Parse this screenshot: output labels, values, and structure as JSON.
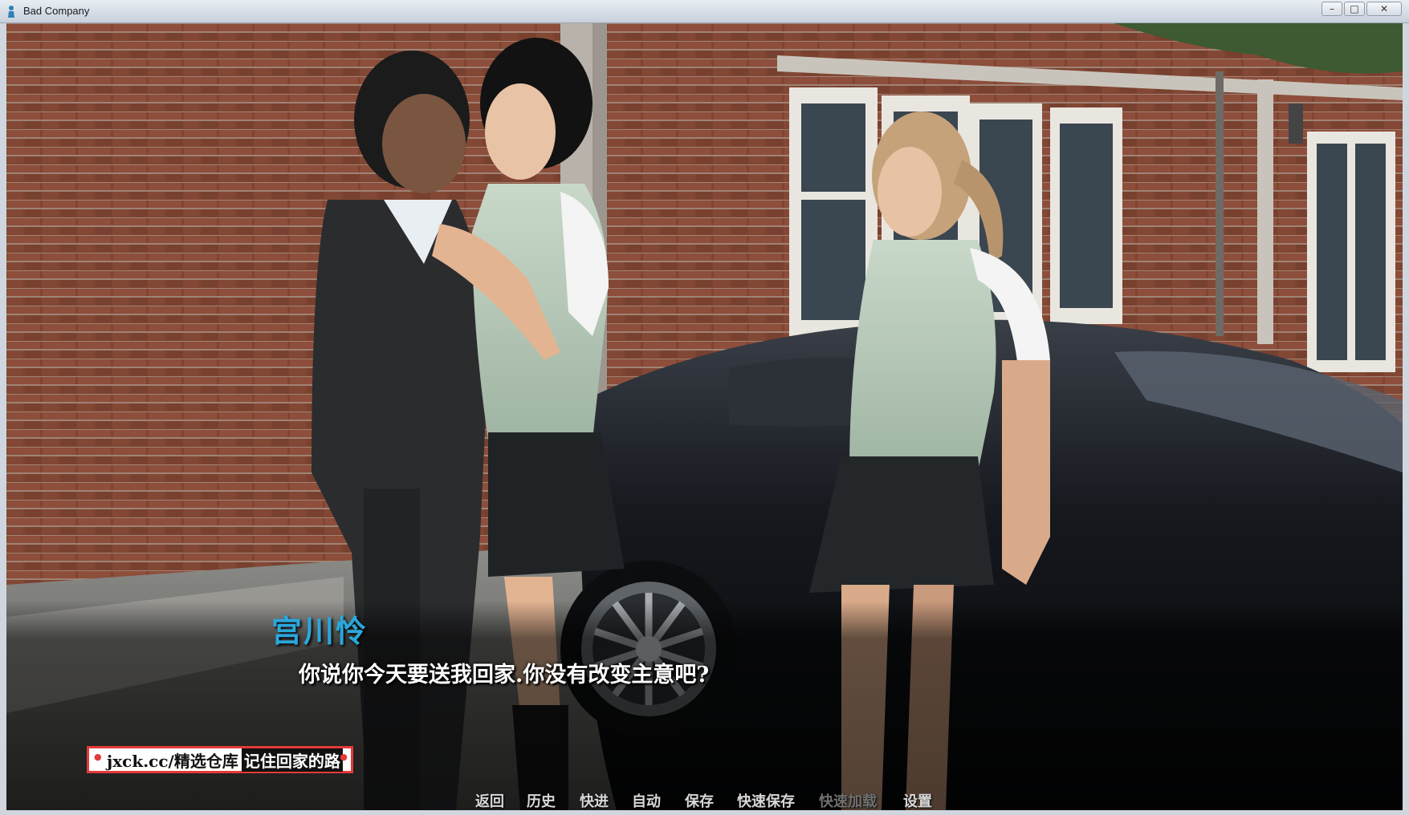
{
  "window": {
    "title": "Bad Company",
    "icon": "app-icon",
    "controls": {
      "minimize": "–",
      "maximize": "□",
      "close": "✕"
    }
  },
  "dialogue": {
    "speaker": "宫川怜",
    "speaker_color": "#2aa8dc",
    "text": "你说你今天要送我回家.你没有改变主意吧?"
  },
  "watermark": {
    "part1": "jxck.cc/精选仓库",
    "part2": "记住回家的路"
  },
  "quick_menu": {
    "items": [
      {
        "label": "返回",
        "enabled": true
      },
      {
        "label": "历史",
        "enabled": true
      },
      {
        "label": "快进",
        "enabled": true
      },
      {
        "label": "自动",
        "enabled": true
      },
      {
        "label": "保存",
        "enabled": true
      },
      {
        "label": "快速保存",
        "enabled": true
      },
      {
        "label": "快速加载",
        "enabled": false
      },
      {
        "label": "设置",
        "enabled": true
      }
    ]
  }
}
